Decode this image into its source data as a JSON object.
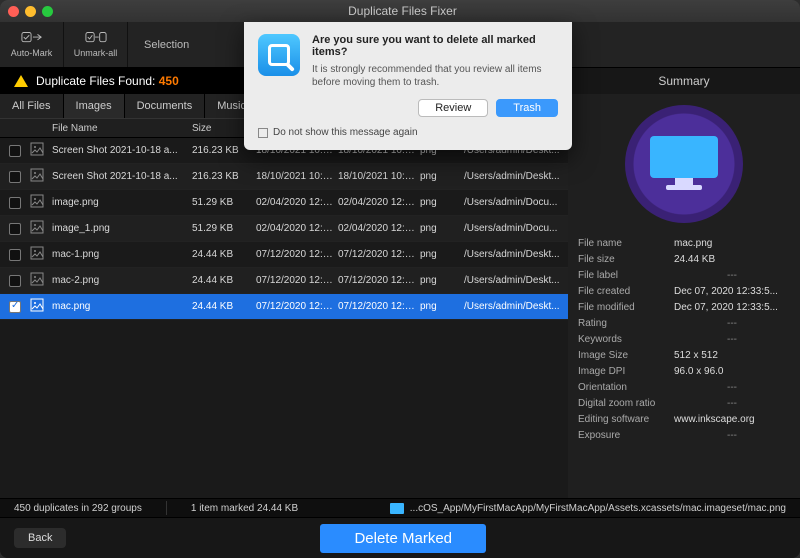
{
  "window": {
    "title": "Duplicate Files Fixer"
  },
  "toolbar": {
    "automark": "Auto-Mark",
    "unmarkall": "Unmark-all",
    "selection": "Selection"
  },
  "warn": {
    "label": "Duplicate Files Found:",
    "count": "450"
  },
  "tabs": {
    "all": "All Files",
    "images": "Images",
    "documents": "Documents",
    "music": "Music"
  },
  "columns": {
    "filename": "File Name",
    "size": "Size"
  },
  "rows": [
    {
      "checked": false,
      "name": "Screen Shot 2021-10-18 a...",
      "size": "216.23 KB",
      "d1": "18/10/2021 10:55:...",
      "d2": "18/10/2021 10:55:...",
      "type": "png",
      "path": "/Users/admin/Deskt..."
    },
    {
      "checked": false,
      "name": "Screen Shot 2021-10-18 a...",
      "size": "216.23 KB",
      "d1": "18/10/2021 10:55:...",
      "d2": "18/10/2021 10:55:...",
      "type": "png",
      "path": "/Users/admin/Deskt..."
    },
    {
      "checked": false,
      "name": "image.png",
      "size": "51.29 KB",
      "d1": "02/04/2020 12:06:...",
      "d2": "02/04/2020 12:06:...",
      "type": "png",
      "path": "/Users/admin/Docu..."
    },
    {
      "checked": false,
      "name": "image_1.png",
      "size": "51.29 KB",
      "d1": "02/04/2020 12:34:...",
      "d2": "02/04/2020 12:34:...",
      "type": "png",
      "path": "/Users/admin/Docu..."
    },
    {
      "checked": false,
      "name": "mac-1.png",
      "size": "24.44 KB",
      "d1": "07/12/2020 12:34:...",
      "d2": "07/12/2020 12:34:...",
      "type": "png",
      "path": "/Users/admin/Deskt..."
    },
    {
      "checked": false,
      "name": "mac-2.png",
      "size": "24.44 KB",
      "d1": "07/12/2020 12:34:...",
      "d2": "07/12/2020 12:34:...",
      "type": "png",
      "path": "/Users/admin/Deskt..."
    },
    {
      "checked": true,
      "name": "mac.png",
      "size": "24.44 KB",
      "d1": "07/12/2020 12:33:...",
      "d2": "07/12/2020 12:33:...",
      "type": "png",
      "path": "/Users/admin/Deskt...",
      "selected": true
    }
  ],
  "summary": {
    "title": "Summary",
    "meta": {
      "File name": "mac.png",
      "File size": "24.44 KB",
      "File label": "---",
      "File created": "Dec 07, 2020 12:33:5...",
      "File modified": "Dec 07, 2020 12:33:5...",
      "Rating": "---",
      "Keywords": "---",
      "Image Size": "512 x 512",
      "Image DPI": "96.0 x 96.0",
      "Orientation": "---",
      "Digital zoom ratio": "---",
      "Editing software": "www.inkscape.org",
      "Exposure": "---"
    }
  },
  "status": {
    "dupgroups": "450 duplicates in 292 groups",
    "marked": "1 item marked 24.44 KB",
    "path": "...cOS_App/MyFirstMacApp/MyFirstMacApp/Assets.xcassets/mac.imageset/mac.png"
  },
  "footer": {
    "back": "Back",
    "delete": "Delete Marked"
  },
  "modal": {
    "title": "Are you sure you want to delete all marked items?",
    "body": "It is strongly recommended that you review all items before moving them to trash.",
    "review": "Review",
    "trash": "Trash",
    "dns": "Do not show this message again"
  }
}
